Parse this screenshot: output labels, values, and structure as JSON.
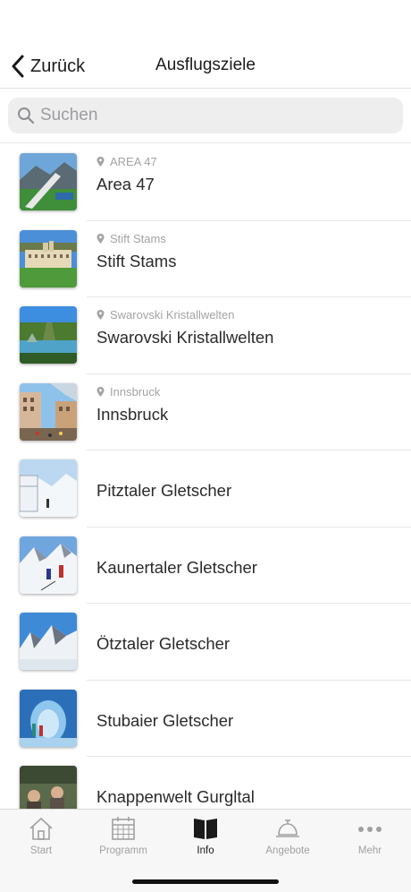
{
  "nav": {
    "back_label": "Zurück",
    "title": "Ausflugsziele"
  },
  "search": {
    "placeholder": "Suchen"
  },
  "items": [
    {
      "location": "AREA 47",
      "title": "Area 47"
    },
    {
      "location": "Stift Stams",
      "title": "Stift Stams"
    },
    {
      "location": "Swarovski Kristallwelten",
      "title": "Swarovski Kristallwelten"
    },
    {
      "location": "Innsbruck",
      "title": "Innsbruck"
    },
    {
      "location": "",
      "title": "Pitztaler Gletscher"
    },
    {
      "location": "",
      "title": "Kaunertaler Gletscher"
    },
    {
      "location": "",
      "title": "Ötztaler Gletscher"
    },
    {
      "location": "",
      "title": "Stubaier Gletscher"
    },
    {
      "location": "",
      "title": "Knappenwelt Gurgltal"
    }
  ],
  "tabs": [
    {
      "label": "Start",
      "icon": "home-icon"
    },
    {
      "label": "Programm",
      "icon": "calendar-icon"
    },
    {
      "label": "Info",
      "icon": "book-icon",
      "active": true
    },
    {
      "label": "Angebote",
      "icon": "service-bell-icon"
    },
    {
      "label": "Mehr",
      "icon": "more-dots-icon"
    }
  ]
}
